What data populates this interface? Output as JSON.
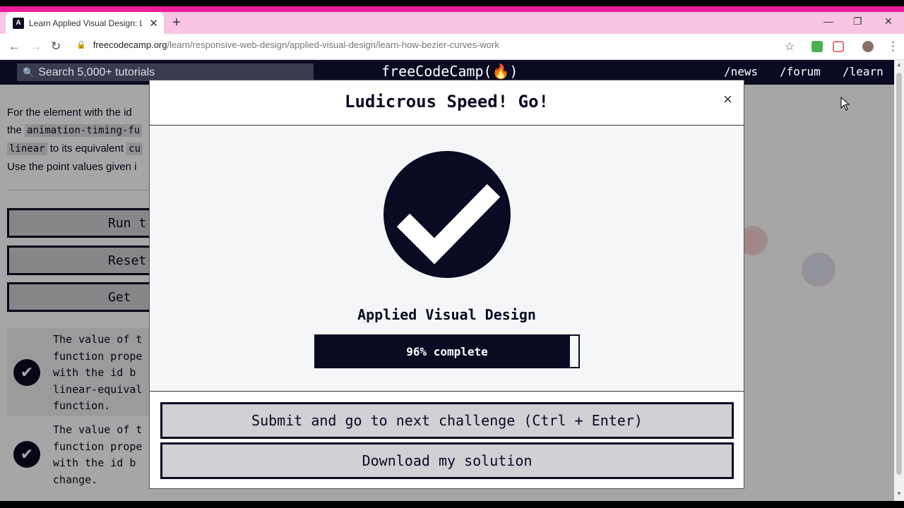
{
  "browser": {
    "tab_title": "Learn Applied Visual Design: Lea",
    "tab_favicon": "A",
    "url_host": "freecodecamp.org",
    "url_path": "/learn/responsive-web-design/applied-visual-design/learn-how-bezier-curves-work"
  },
  "site_nav": {
    "search_placeholder": "Search 5,000+ tutorials",
    "logo": "freeCodeCamp(🔥)",
    "links": [
      "/news",
      "/forum",
      "/learn"
    ]
  },
  "lesson": {
    "line1_a": "For the element with the id",
    "line2_a": "the",
    "line2_code": "animation-timing-fu",
    "line3_code1": "linear",
    "line3_b": "to its equivalent",
    "line3_code2": "cu",
    "line4": "Use the point values given i"
  },
  "left_buttons": [
    "Run t",
    "Reset",
    "Get"
  ],
  "tests": [
    {
      "text": "The value of t\nfunction prope\nwith the id b\nlinear-equival\nfunction."
    },
    {
      "text": "The value of t\nfunction prope\nwith the id b\nchange."
    }
  ],
  "modal": {
    "title": "Ludicrous Speed! Go!",
    "close": "×",
    "cert_title": "Applied Visual Design",
    "progress_percent": 96,
    "progress_text": "96% complete",
    "submit_label": "Submit and go to next challenge (Ctrl + Enter)",
    "download_label": "Download my solution"
  },
  "colors": {
    "primary": "#0a0a23",
    "tab_strip": "#f8c6e3",
    "accent_line": "#ea1e9b",
    "button_bg": "#d0d0d5"
  }
}
